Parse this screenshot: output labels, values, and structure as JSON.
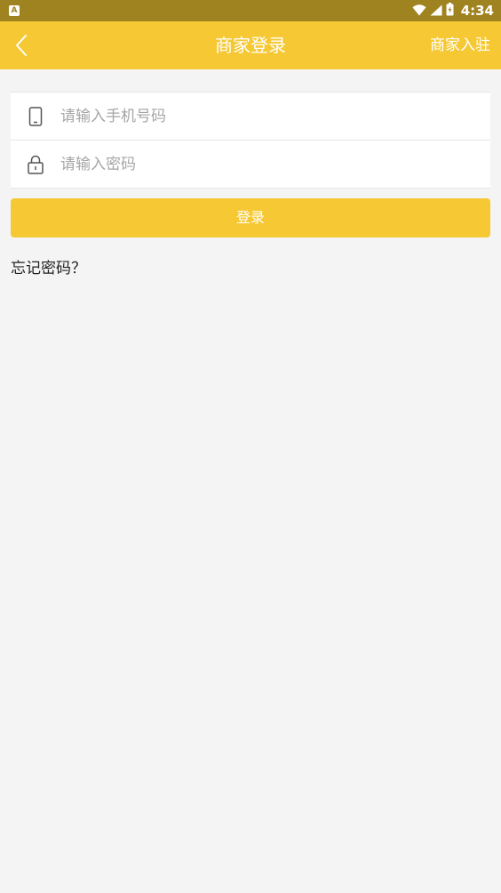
{
  "status_bar": {
    "left_icon_label": "A",
    "time": "4:34"
  },
  "app_bar": {
    "title": "商家登录",
    "action_label": "商家入驻"
  },
  "form": {
    "phone_placeholder": "请输入手机号码",
    "password_placeholder": "请输入密码"
  },
  "login_button_label": "登录",
  "forgot_password_label": "忘记密码？",
  "colors": {
    "accent": "#f5c834",
    "status_bar": "#a08321",
    "background": "#f4f4f4"
  },
  "icons": {
    "back": "chevron-left-icon",
    "phone": "phone-icon",
    "lock": "lock-icon",
    "wifi": "wifi-icon",
    "signal": "signal-icon",
    "battery": "battery-icon"
  }
}
